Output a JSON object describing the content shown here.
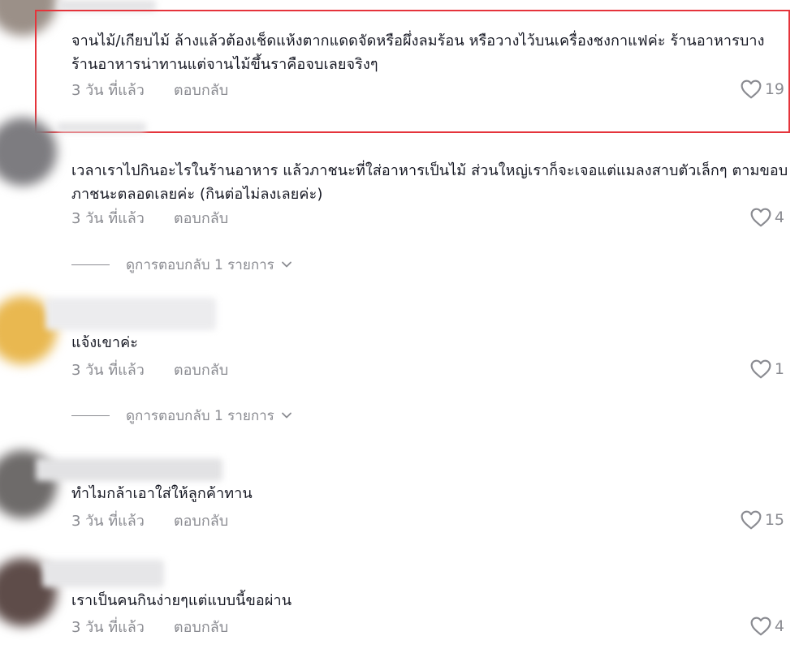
{
  "comments": [
    {
      "text": "จานไม้/เกียบไม้ ล้างแล้วต้องเช็ดแห้งตากแดดจัดหรือผึ่งลมร้อน หรือวางไว้บนเครื่องชงกาแฟค่ะ ร้านอาหารบางร้านอาหารน่าทานแต่จานไม้ขึ้นราคือจบเลยจริงๆ",
      "time": "3 วัน ที่แล้ว",
      "reply_label": "ตอบกลับ",
      "likes": "19",
      "highlighted": true
    },
    {
      "text": "เวลาเราไปกินอะไรในร้านอาหาร แล้วภาชนะที่ใส่อาหารเป็นไม้ ส่วนใหญ่เราก็จะเจอแต่แมลงสาบตัวเล็กๆ ตามขอบภาชนะตลอดเลยค่ะ (กินต่อไม่ลงเลยค่ะ)",
      "time": "3 วัน ที่แล้ว",
      "reply_label": "ตอบกลับ",
      "likes": "4",
      "view_replies": "ดูการตอบกลับ 1 รายการ"
    },
    {
      "text": "แจ้งเขาค่ะ",
      "time": "3 วัน ที่แล้ว",
      "reply_label": "ตอบกลับ",
      "likes": "1",
      "view_replies": "ดูการตอบกลับ 1 รายการ"
    },
    {
      "text": "ทำไมกล้าเอาใส่ให้ลูกค้าทาน",
      "time": "3 วัน ที่แล้ว",
      "reply_label": "ตอบกลับ",
      "likes": "15"
    },
    {
      "text": "เราเป็นคนกินง่ายๆแต่แบบนี้ขอผ่าน",
      "time": "3 วัน ที่แล้ว",
      "reply_label": "ตอบกลับ",
      "likes": "4"
    }
  ],
  "colors": {
    "text": "#161823",
    "muted": "#8a8b91",
    "highlight_border": "#e5343b"
  },
  "icons": {
    "like": "heart-outline-icon",
    "expand": "chevron-down-icon"
  }
}
